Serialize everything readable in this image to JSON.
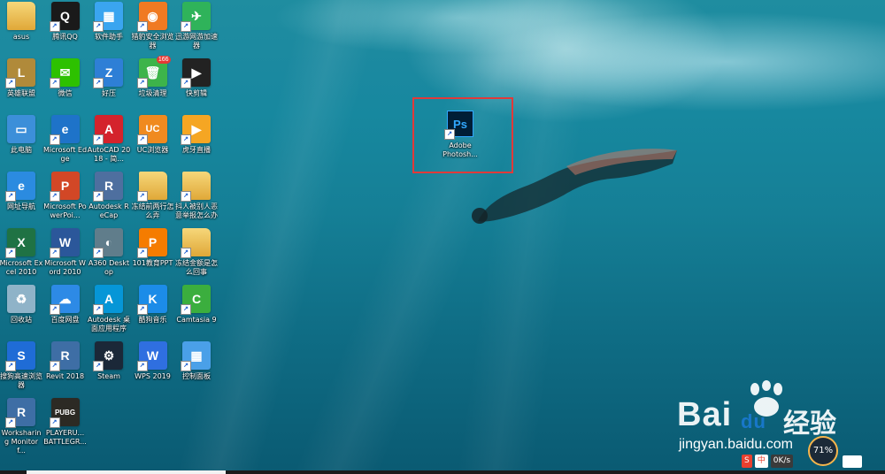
{
  "desktop": {
    "icons": [
      {
        "label": "asus",
        "icon": "folder-icon"
      },
      {
        "label": "腾讯QQ",
        "icon": "qq-icon"
      },
      {
        "label": "软件助手",
        "icon": "software-assistant-icon"
      },
      {
        "label": "猎豹安全浏览器",
        "icon": "cheetah-browser-icon"
      },
      {
        "label": "迅游网游加速器",
        "icon": "xunyou-icon"
      },
      {
        "label": "英雄联盟",
        "icon": "league-of-legends-icon"
      },
      {
        "label": "微信",
        "icon": "wechat-icon"
      },
      {
        "label": "好压",
        "icon": "haozip-icon"
      },
      {
        "label": "垃圾清理",
        "icon": "trash-cleanup-icon",
        "badge": "166"
      },
      {
        "label": "快剪辑",
        "icon": "kuaijianji-icon"
      },
      {
        "label": "此电脑",
        "icon": "this-pc-icon"
      },
      {
        "label": "Microsoft Edge",
        "icon": "edge-icon"
      },
      {
        "label": "AutoCAD 2018 - 简...",
        "icon": "autocad-icon"
      },
      {
        "label": "UC浏览器",
        "icon": "uc-browser-icon"
      },
      {
        "label": "虎牙直播",
        "icon": "huya-icon"
      },
      {
        "label": "网址导航",
        "icon": "ie-icon"
      },
      {
        "label": "Microsoft PowerPoi...",
        "icon": "powerpoint-icon"
      },
      {
        "label": "Autodesk ReCap",
        "icon": "recap-icon"
      },
      {
        "label": "冻结前两行怎么弄",
        "icon": "folder-icon"
      },
      {
        "label": "抖人被别人恶意举报怎么办",
        "icon": "folder-icon"
      },
      {
        "label": "Microsoft Excel 2010",
        "icon": "excel-icon"
      },
      {
        "label": "Microsoft Word 2010",
        "icon": "word-icon"
      },
      {
        "label": "A360 Desktop",
        "icon": "a360-icon"
      },
      {
        "label": "101教育PPT",
        "icon": "101ppt-icon"
      },
      {
        "label": "冻结金额是怎么回事",
        "icon": "folder-icon"
      },
      {
        "label": "回收站",
        "icon": "recycle-bin-icon"
      },
      {
        "label": "百度网盘",
        "icon": "baidu-netdisk-icon"
      },
      {
        "label": "Autodesk 桌面应用程序",
        "icon": "autodesk-app-icon"
      },
      {
        "label": "酷狗音乐",
        "icon": "kugou-icon"
      },
      {
        "label": "Camtasia 9",
        "icon": "camtasia-icon"
      },
      {
        "label": "搜狗高速浏览器",
        "icon": "sogou-browser-icon"
      },
      {
        "label": "Revit 2018",
        "icon": "revit-icon"
      },
      {
        "label": "Steam",
        "icon": "steam-icon"
      },
      {
        "label": "WPS 2019",
        "icon": "wps-icon"
      },
      {
        "label": "控制面板",
        "icon": "control-panel-icon"
      },
      {
        "label": "Worksharing Monitor f...",
        "icon": "worksharing-monitor-icon"
      },
      {
        "label": "PLAYERU... BATTLEGR...",
        "icon": "pubg-icon"
      }
    ],
    "selected_icon": {
      "label": "Adobe Photosh...",
      "icon": "photoshop-icon",
      "glyph": "Ps"
    }
  },
  "watermark": {
    "brand": "Bai",
    "brand2": "du",
    "chinese": "经验",
    "url": "jingyan.baidu.com"
  },
  "tray": {
    "ime_label": "中",
    "speed_value": "71%",
    "net_speed": "0K/s"
  }
}
